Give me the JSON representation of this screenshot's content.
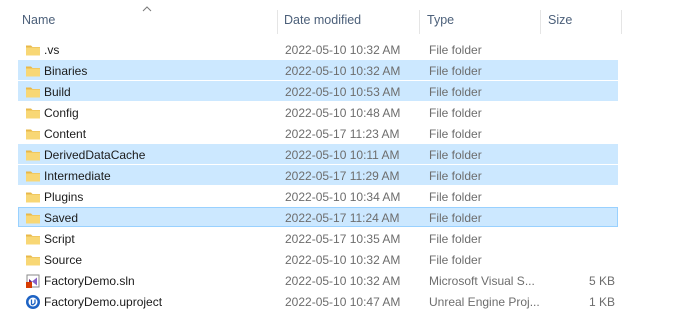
{
  "columns": {
    "name": "Name",
    "date": "Date modified",
    "type": "Type",
    "size": "Size"
  },
  "rows": [
    {
      "name": ".vs",
      "date": "2022-05-10 10:32 AM",
      "type": "File folder",
      "size": "",
      "icon": "folder-icon",
      "selected": false
    },
    {
      "name": "Binaries",
      "date": "2022-05-10 10:32 AM",
      "type": "File folder",
      "size": "",
      "icon": "folder-icon",
      "selected": true
    },
    {
      "name": "Build",
      "date": "2022-05-10 10:53 AM",
      "type": "File folder",
      "size": "",
      "icon": "folder-icon",
      "selected": true
    },
    {
      "name": "Config",
      "date": "2022-05-10 10:48 AM",
      "type": "File folder",
      "size": "",
      "icon": "folder-icon",
      "selected": false
    },
    {
      "name": "Content",
      "date": "2022-05-17 11:23 AM",
      "type": "File folder",
      "size": "",
      "icon": "folder-icon",
      "selected": false
    },
    {
      "name": "DerivedDataCache",
      "date": "2022-05-10 10:11 AM",
      "type": "File folder",
      "size": "",
      "icon": "folder-icon",
      "selected": true
    },
    {
      "name": "Intermediate",
      "date": "2022-05-17 11:29 AM",
      "type": "File folder",
      "size": "",
      "icon": "folder-icon",
      "selected": true
    },
    {
      "name": "Plugins",
      "date": "2022-05-10 10:34 AM",
      "type": "File folder",
      "size": "",
      "icon": "folder-icon",
      "selected": false
    },
    {
      "name": "Saved",
      "date": "2022-05-17 11:24 AM",
      "type": "File folder",
      "size": "",
      "icon": "folder-icon",
      "selected": true,
      "focused": true
    },
    {
      "name": "Script",
      "date": "2022-05-17 10:35 AM",
      "type": "File folder",
      "size": "",
      "icon": "folder-icon",
      "selected": false
    },
    {
      "name": "Source",
      "date": "2022-05-10 10:32 AM",
      "type": "File folder",
      "size": "",
      "icon": "folder-icon",
      "selected": false
    },
    {
      "name": "FactoryDemo.sln",
      "date": "2022-05-10 10:32 AM",
      "type": "Microsoft Visual S...",
      "size": "5 KB",
      "icon": "visual-studio-solution-icon",
      "selected": false
    },
    {
      "name": "FactoryDemo.uproject",
      "date": "2022-05-10 10:47 AM",
      "type": "Unreal Engine Proj...",
      "size": "1 KB",
      "icon": "unreal-engine-icon",
      "selected": false
    }
  ],
  "colors": {
    "selection": "#cce8ff",
    "focus_border": "#99d1ff",
    "header_text": "#4c607a",
    "folder": "#f8d775"
  }
}
